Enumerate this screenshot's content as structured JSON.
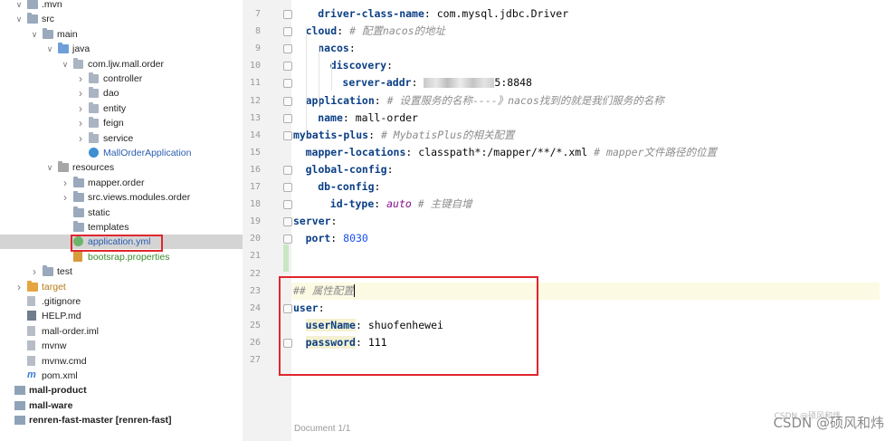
{
  "tree": [
    {
      "depth": 1,
      "arrow": "down",
      "icon": "folder",
      "label": ".mvn",
      "partial": true
    },
    {
      "depth": 1,
      "arrow": "down",
      "icon": "folder",
      "label": "src"
    },
    {
      "depth": 2,
      "arrow": "down",
      "icon": "folder",
      "label": "main"
    },
    {
      "depth": 3,
      "arrow": "down",
      "icon": "folder-src",
      "label": "java"
    },
    {
      "depth": 4,
      "arrow": "down",
      "icon": "package",
      "label": "com.ljw.mall.order"
    },
    {
      "depth": 5,
      "arrow": "right",
      "icon": "package",
      "label": "controller"
    },
    {
      "depth": 5,
      "arrow": "right",
      "icon": "package",
      "label": "dao"
    },
    {
      "depth": 5,
      "arrow": "right",
      "icon": "package",
      "label": "entity"
    },
    {
      "depth": 5,
      "arrow": "right",
      "icon": "package",
      "label": "feign"
    },
    {
      "depth": 5,
      "arrow": "right",
      "icon": "package",
      "label": "service"
    },
    {
      "depth": 5,
      "arrow": "none",
      "icon": "class",
      "label": "MallOrderApplication",
      "color": "blue"
    },
    {
      "depth": 3,
      "arrow": "down",
      "icon": "folder-res",
      "label": "resources"
    },
    {
      "depth": 4,
      "arrow": "right",
      "icon": "folder",
      "label": "mapper.order"
    },
    {
      "depth": 4,
      "arrow": "right",
      "icon": "folder",
      "label": "src.views.modules.order"
    },
    {
      "depth": 4,
      "arrow": "none",
      "icon": "folder",
      "label": "static"
    },
    {
      "depth": 4,
      "arrow": "none",
      "icon": "folder",
      "label": "templates"
    },
    {
      "depth": 4,
      "arrow": "none",
      "icon": "yml",
      "label": "application.yml",
      "color": "blue",
      "selected": true
    },
    {
      "depth": 4,
      "arrow": "none",
      "icon": "properties",
      "label": "bootsrap.properties",
      "color": "green"
    },
    {
      "depth": 2,
      "arrow": "right",
      "icon": "folder",
      "label": "test"
    },
    {
      "depth": 1,
      "arrow": "right",
      "icon": "folder-orange",
      "label": "target",
      "color": "orange"
    },
    {
      "depth": 1,
      "arrow": "none",
      "icon": "file",
      "label": ".gitignore"
    },
    {
      "depth": 1,
      "arrow": "none",
      "icon": "md",
      "label": "HELP.md"
    },
    {
      "depth": 1,
      "arrow": "none",
      "icon": "file",
      "label": "mall-order.iml"
    },
    {
      "depth": 1,
      "arrow": "none",
      "icon": "file",
      "label": "mvnw"
    },
    {
      "depth": 1,
      "arrow": "none",
      "icon": "file",
      "label": "mvnw.cmd"
    },
    {
      "depth": 1,
      "arrow": "none",
      "icon": "pom",
      "label": "pom.xml"
    },
    {
      "depth": 0,
      "arrow": "none",
      "icon": "module",
      "label": "mall-product",
      "bold": true
    },
    {
      "depth": 0,
      "arrow": "none",
      "icon": "module",
      "label": "mall-ware",
      "bold": true
    },
    {
      "depth": 0,
      "arrow": "none",
      "icon": "module",
      "label": "renren-fast-master [renren-fast]",
      "bold": true
    }
  ],
  "code": [
    {
      "n": "7",
      "indent": 2,
      "fold": true,
      "parts": [
        [
          "key",
          "driver-class-name"
        ],
        [
          "plain",
          ": com.mysql.jdbc.Driver"
        ]
      ]
    },
    {
      "n": "8",
      "indent": 1,
      "fold": true,
      "parts": [
        [
          "key",
          "cloud"
        ],
        [
          "plain",
          ": "
        ],
        [
          "cmt",
          "# 配置nacos的地址"
        ]
      ]
    },
    {
      "n": "9",
      "indent": 2,
      "fold": true,
      "parts": [
        [
          "key",
          "nacos"
        ],
        [
          "plain",
          ":"
        ]
      ]
    },
    {
      "n": "10",
      "indent": 3,
      "fold": true,
      "parts": [
        [
          "key",
          "discovery"
        ],
        [
          "plain",
          ":"
        ]
      ]
    },
    {
      "n": "11",
      "indent": 4,
      "fold": true,
      "parts": [
        [
          "key",
          "server-addr"
        ],
        [
          "plain",
          ": "
        ],
        [
          "blur",
          ""
        ],
        [
          "plain",
          "5:8848"
        ]
      ]
    },
    {
      "n": "12",
      "indent": 1,
      "fold": true,
      "parts": [
        [
          "key",
          "application"
        ],
        [
          "plain",
          ": "
        ],
        [
          "cmt",
          "# 设置服务的名称----》nacos找到的就是我们服务的名称"
        ]
      ]
    },
    {
      "n": "13",
      "indent": 2,
      "fold": true,
      "parts": [
        [
          "key",
          "name"
        ],
        [
          "plain",
          ": mall-order"
        ]
      ]
    },
    {
      "n": "14",
      "indent": 0,
      "fold": true,
      "parts": [
        [
          "key",
          "mybatis-plus"
        ],
        [
          "plain",
          ": "
        ],
        [
          "cmt",
          "# MybatisPlus的相关配置"
        ]
      ]
    },
    {
      "n": "15",
      "indent": 1,
      "fold": false,
      "parts": [
        [
          "key",
          "mapper-locations"
        ],
        [
          "plain",
          ": classpath*:/mapper/**/*.xml "
        ],
        [
          "cmt",
          "# mapper文件路径的位置"
        ]
      ]
    },
    {
      "n": "16",
      "indent": 1,
      "fold": true,
      "parts": [
        [
          "key",
          "global-config"
        ],
        [
          "plain",
          ":"
        ]
      ]
    },
    {
      "n": "17",
      "indent": 2,
      "fold": true,
      "parts": [
        [
          "key",
          "db-config"
        ],
        [
          "plain",
          ":"
        ]
      ]
    },
    {
      "n": "18",
      "indent": 3,
      "fold": true,
      "parts": [
        [
          "key",
          "id-type"
        ],
        [
          "plain",
          ": "
        ],
        [
          "kw",
          "auto"
        ],
        [
          "plain",
          " "
        ],
        [
          "cmt",
          "# 主键自增"
        ]
      ]
    },
    {
      "n": "19",
      "indent": 0,
      "fold": true,
      "parts": [
        [
          "key",
          "server"
        ],
        [
          "plain",
          ":"
        ]
      ]
    },
    {
      "n": "20",
      "indent": 1,
      "fold": true,
      "parts": [
        [
          "key",
          "port"
        ],
        [
          "plain",
          ": "
        ],
        [
          "num",
          "8030"
        ]
      ]
    },
    {
      "n": "21",
      "indent": 0,
      "fold": false,
      "parts": []
    },
    {
      "n": "22",
      "indent": 0,
      "fold": false,
      "parts": []
    },
    {
      "n": "23",
      "indent": 0,
      "fold": false,
      "current": true,
      "parts": [
        [
          "cmt",
          "## 属性配置"
        ],
        [
          "caret",
          ""
        ]
      ]
    },
    {
      "n": "24",
      "indent": 0,
      "fold": true,
      "parts": [
        [
          "key",
          "user"
        ],
        [
          "plain",
          ":"
        ]
      ]
    },
    {
      "n": "25",
      "indent": 1,
      "fold": false,
      "parts": [
        [
          "keyhl",
          "userName"
        ],
        [
          "plain",
          ": shuofenhewei"
        ]
      ]
    },
    {
      "n": "26",
      "indent": 1,
      "fold": true,
      "parts": [
        [
          "keyhl",
          "password"
        ],
        [
          "plain",
          ": 111"
        ]
      ]
    },
    {
      "n": "27",
      "indent": 0,
      "fold": false,
      "parts": []
    }
  ],
  "status": {
    "text": "Document 1/1"
  },
  "watermark": {
    "main": "CSDN @硕风和炜",
    "faint": "CSDN @硕风和炜"
  },
  "colors": {
    "key": "#0b3f85",
    "comment": "#8c8c8c",
    "number": "#1750eb",
    "highlight": "#e0262e"
  }
}
